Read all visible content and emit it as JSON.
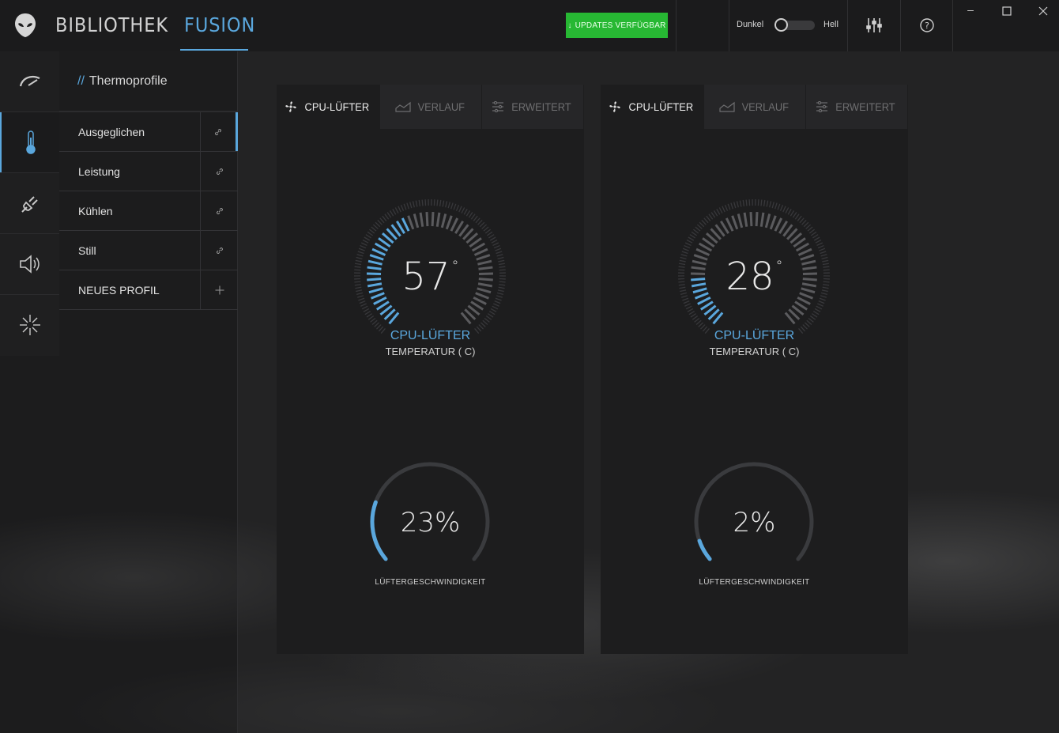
{
  "header": {
    "tabs": [
      {
        "label": "BIBLIOTHEK",
        "active": false
      },
      {
        "label": "FUSION",
        "active": true
      }
    ],
    "update_button": "UPDATES VERFÜGBAR",
    "theme_dark": "Dunkel",
    "theme_light": "Hell",
    "accent_color": "#5aa7dd",
    "update_color": "#27b833"
  },
  "rail": {
    "items": [
      {
        "icon": "speedometer-icon",
        "active": false
      },
      {
        "icon": "thermometer-icon",
        "active": true
      },
      {
        "icon": "power-plug-icon",
        "active": false
      },
      {
        "icon": "speaker-icon",
        "active": false
      },
      {
        "icon": "alienfx-burst-icon",
        "active": false
      }
    ]
  },
  "profiles": {
    "title": "Thermoprofile",
    "items": [
      {
        "label": "Ausgeglichen",
        "action_icon": "link-icon",
        "active": true
      },
      {
        "label": "Leistung",
        "action_icon": "link-icon",
        "active": false
      },
      {
        "label": "Kühlen",
        "action_icon": "link-icon",
        "active": false
      },
      {
        "label": "Still",
        "action_icon": "link-icon",
        "active": false
      },
      {
        "label": "NEUES PROFIL",
        "action_icon": "plus-icon",
        "active": false
      }
    ]
  },
  "cards": [
    {
      "tabs": [
        "CPU-LÜFTER",
        "VERLAUF",
        "ERWEITERT"
      ],
      "temperature": "57",
      "temperature_fraction": 0.42,
      "gauge_title": "CPU-LÜFTER",
      "gauge_subtitle": "TEMPERATUR ( C)",
      "fan_speed": "23%",
      "fan_fraction": 0.23,
      "fan_label": "LÜFTERGESCHWINDIGKEIT"
    },
    {
      "tabs": [
        "CPU-LÜFTER",
        "VERLAUF",
        "ERWEITERT"
      ],
      "temperature": "28",
      "temperature_fraction": 0.17,
      "gauge_title": "CPU-LÜFTER",
      "gauge_subtitle": "TEMPERATUR ( C)",
      "fan_speed": "2%",
      "fan_fraction": 0.08,
      "fan_label": "LÜFTERGESCHWINDIGKEIT"
    }
  ]
}
